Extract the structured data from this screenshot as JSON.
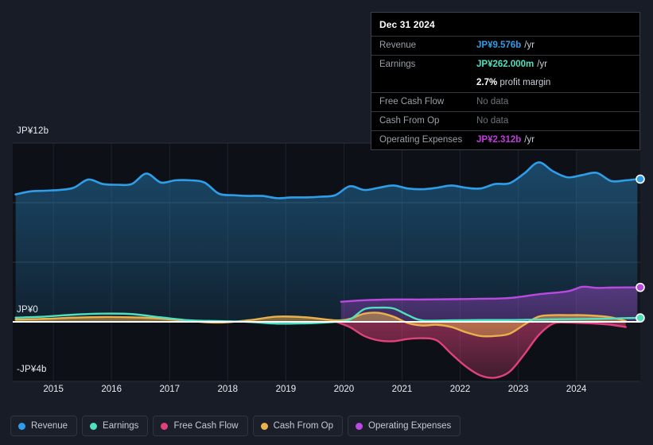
{
  "chart_data": {
    "type": "area",
    "title": "",
    "xlabel": "",
    "ylabel": "",
    "currency": "JP¥",
    "grid": true,
    "legend_position": "bottom",
    "axis": {
      "y_top_label": "JP¥12b",
      "y_zero_label": "JP¥0",
      "y_bottom_label": "-JP¥4b",
      "ylim": [
        -4,
        12
      ],
      "gridlines": [
        12,
        8,
        4,
        0,
        -4
      ],
      "x_tick_labels": [
        "2015",
        "2016",
        "2017",
        "2018",
        "2019",
        "2020",
        "2021",
        "2022",
        "2023",
        "2024"
      ],
      "xlim": [
        2014.3,
        2025.1
      ]
    },
    "series": [
      {
        "name": "Revenue",
        "color": "#2f9ee8",
        "fill": true,
        "x": [
          2014.35,
          2014.6,
          2014.85,
          2015.1,
          2015.35,
          2015.6,
          2015.85,
          2016.1,
          2016.35,
          2016.6,
          2016.85,
          2017.1,
          2017.35,
          2017.6,
          2017.85,
          2018.1,
          2018.35,
          2018.6,
          2018.85,
          2019.1,
          2019.35,
          2019.6,
          2019.85,
          2020.1,
          2020.35,
          2020.6,
          2020.85,
          2021.1,
          2021.35,
          2021.6,
          2021.85,
          2022.1,
          2022.35,
          2022.6,
          2022.85,
          2023.1,
          2023.35,
          2023.6,
          2023.85,
          2024.1,
          2024.35,
          2024.6,
          2024.85,
          2025.05
        ],
        "values": [
          8.55,
          8.75,
          8.8,
          8.85,
          9.0,
          9.55,
          9.25,
          9.2,
          9.25,
          9.95,
          9.35,
          9.5,
          9.5,
          9.35,
          8.6,
          8.5,
          8.45,
          8.45,
          8.3,
          8.35,
          8.35,
          8.4,
          8.5,
          9.1,
          8.85,
          9.0,
          9.15,
          8.95,
          8.9,
          9.0,
          9.15,
          9.0,
          8.95,
          9.25,
          9.3,
          9.95,
          10.7,
          10.1,
          9.7,
          9.85,
          10.0,
          9.45,
          9.5,
          9.576
        ]
      },
      {
        "name": "Earnings",
        "color": "#4fe0c0",
        "fill": false,
        "x": [
          2014.35,
          2014.85,
          2015.35,
          2015.85,
          2016.35,
          2016.85,
          2017.35,
          2017.85,
          2018.35,
          2018.85,
          2019.35,
          2019.85,
          2020.1,
          2020.35,
          2020.6,
          2020.85,
          2021.1,
          2021.35,
          2021.85,
          2022.35,
          2022.85,
          2023.35,
          2023.85,
          2024.35,
          2024.85,
          2025.05
        ],
        "values": [
          0.28,
          0.35,
          0.48,
          0.55,
          0.52,
          0.3,
          0.1,
          0.05,
          0.0,
          -0.12,
          -0.1,
          0.0,
          0.15,
          0.85,
          0.95,
          0.9,
          0.45,
          0.1,
          0.1,
          0.12,
          0.12,
          0.15,
          0.18,
          0.2,
          0.25,
          0.262
        ]
      },
      {
        "name": "Free Cash Flow",
        "color": "#e0417a",
        "fill": true,
        "x": [
          2019.85,
          2020.1,
          2020.35,
          2020.6,
          2020.85,
          2021.1,
          2021.35,
          2021.6,
          2021.85,
          2022.1,
          2022.35,
          2022.6,
          2022.85,
          2023.1,
          2023.35,
          2023.6,
          2023.85,
          2024.1,
          2024.35,
          2024.6,
          2024.85
        ],
        "values": [
          0.02,
          -0.35,
          -0.95,
          -1.25,
          -1.3,
          -1.15,
          -1.1,
          -1.25,
          -2.15,
          -3.0,
          -3.6,
          -3.75,
          -3.35,
          -2.2,
          -0.9,
          -0.12,
          -0.05,
          -0.08,
          -0.12,
          -0.2,
          -0.35
        ]
      },
      {
        "name": "Cash From Op",
        "color": "#eab04d",
        "fill": true,
        "x": [
          2014.35,
          2014.85,
          2015.35,
          2015.85,
          2016.35,
          2016.85,
          2017.35,
          2017.85,
          2018.35,
          2018.85,
          2019.35,
          2019.85,
          2020.1,
          2020.35,
          2020.6,
          2020.85,
          2021.1,
          2021.35,
          2021.6,
          2021.85,
          2022.1,
          2022.35,
          2022.6,
          2022.85,
          2023.1,
          2023.35,
          2023.6,
          2023.85,
          2024.1,
          2024.35,
          2024.6,
          2024.85
        ],
        "values": [
          0.15,
          0.2,
          0.28,
          0.32,
          0.3,
          0.22,
          0.05,
          -0.05,
          0.1,
          0.35,
          0.3,
          0.1,
          0.2,
          0.55,
          0.6,
          0.35,
          -0.08,
          -0.25,
          -0.2,
          -0.35,
          -0.7,
          -0.95,
          -0.95,
          -0.8,
          -0.2,
          0.35,
          0.45,
          0.45,
          0.45,
          0.4,
          0.3,
          0.05
        ]
      },
      {
        "name": "Operating Expenses",
        "color": "#b84ae0",
        "fill": true,
        "x": [
          2019.95,
          2020.35,
          2020.85,
          2021.35,
          2021.85,
          2022.35,
          2022.85,
          2023.35,
          2023.85,
          2024.1,
          2024.35,
          2024.6,
          2024.85,
          2025.05
        ],
        "values": [
          1.35,
          1.45,
          1.5,
          1.5,
          1.52,
          1.55,
          1.6,
          1.85,
          2.05,
          2.35,
          2.28,
          2.3,
          2.31,
          2.312
        ]
      }
    ],
    "endpoints": [
      {
        "name": "Revenue",
        "color": "#2f9ee8",
        "value": 9.576
      },
      {
        "name": "Operating Expenses",
        "color": "#b84ae0",
        "value": 2.312
      },
      {
        "name": "Earnings",
        "color": "#4fe0c0",
        "value": 0.262
      }
    ]
  },
  "tooltip": {
    "date": "Dec 31 2024",
    "rows": [
      {
        "label": "Revenue",
        "value": "JP¥9.576b",
        "unit": "/yr",
        "color": "#2f9ee8",
        "nodata": false
      },
      {
        "label": "Earnings",
        "value": "JP¥262.000m",
        "unit": "/yr",
        "color": "#4fe0c0",
        "nodata": false
      },
      {
        "label": "",
        "value": "2.7%",
        "unit": "profit margin",
        "color": "#ffffff",
        "nodata": false,
        "sub": true
      },
      {
        "label": "Free Cash Flow",
        "value": "No data",
        "unit": "",
        "color": "#6e747d",
        "nodata": true
      },
      {
        "label": "Cash From Op",
        "value": "No data",
        "unit": "",
        "color": "#6e747d",
        "nodata": true
      },
      {
        "label": "Operating Expenses",
        "value": "JP¥2.312b",
        "unit": "/yr",
        "color": "#c23ae0",
        "nodata": false
      }
    ]
  },
  "legend": {
    "items": [
      {
        "label": "Revenue",
        "color": "#2f9ee8"
      },
      {
        "label": "Earnings",
        "color": "#4fe0c0"
      },
      {
        "label": "Free Cash Flow",
        "color": "#e0417a"
      },
      {
        "label": "Cash From Op",
        "color": "#eab04d"
      },
      {
        "label": "Operating Expenses",
        "color": "#b84ae0"
      }
    ]
  },
  "theme": {
    "background": "#171c26",
    "plot_background": "#0d1117",
    "gridline": "#2a313c",
    "zero_line": "#ffffff",
    "text": "#e9edf2"
  }
}
